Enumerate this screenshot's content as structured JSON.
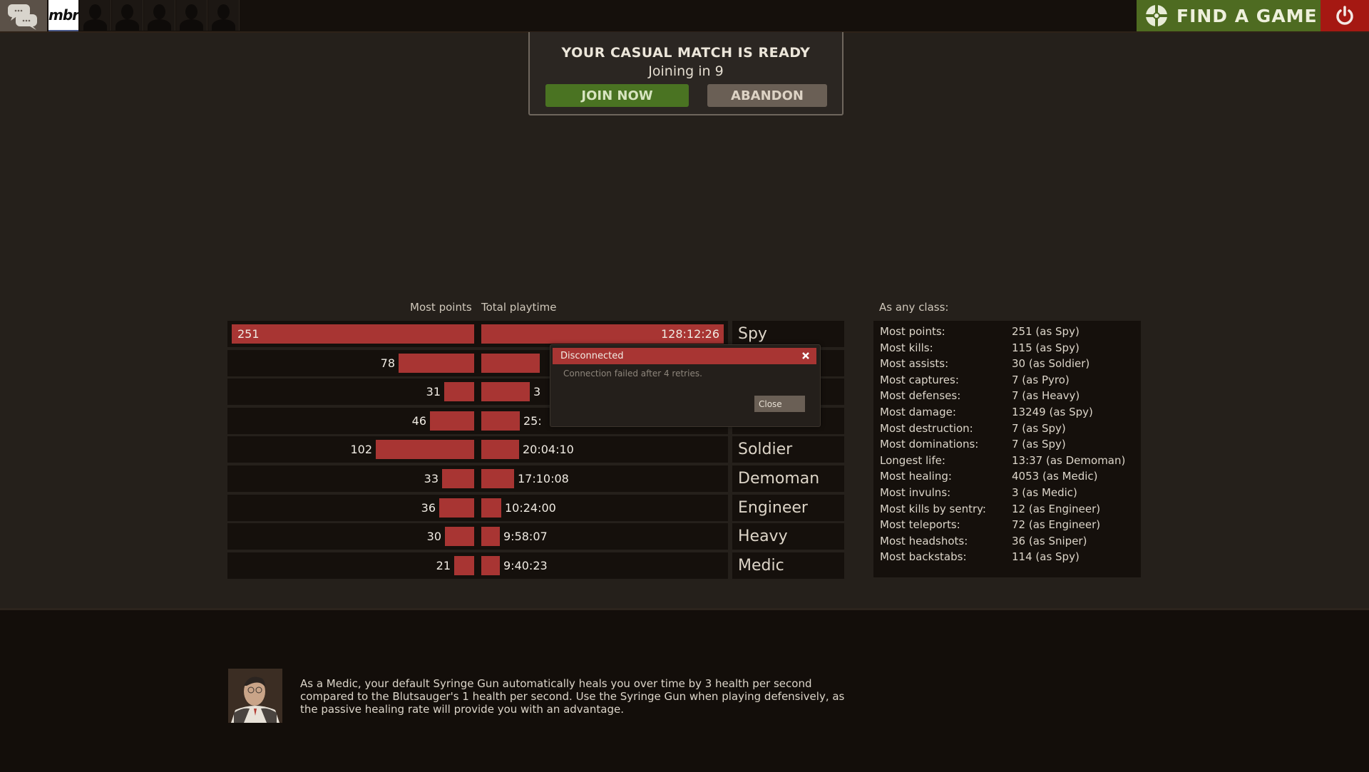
{
  "topbar": {
    "chat_icon": "chat-bubbles-icon",
    "party_avatar_label": "mbr",
    "friend_slots": 5,
    "find_game_label": "FIND A GAME",
    "find_game_color": "#4e6b21",
    "power_color": "#a51812"
  },
  "match_ready": {
    "title": "YOUR CASUAL MATCH IS READY",
    "subtitle": "Joining in 9",
    "join_label": "JOIN NOW",
    "abandon_label": "ABANDON"
  },
  "stats": {
    "col_points": "Most points",
    "col_playtime": "Total playtime",
    "bar_color": "#a83533",
    "rows": [
      {
        "points": "251",
        "points_value": 251,
        "time": "128:12:26",
        "time_value_hours": 128.207,
        "class": "Spy"
      },
      {
        "points": "78",
        "points_value": 78,
        "time": "",
        "time_value_hours": null,
        "class": ""
      },
      {
        "points": "31",
        "points_value": 31,
        "time": "3",
        "time_value_hours": null,
        "class": ""
      },
      {
        "points": "46",
        "points_value": 46,
        "time": "25:",
        "time_value_hours": null,
        "class": ""
      },
      {
        "points": "102",
        "points_value": 102,
        "time": "20:04:10",
        "time_value_hours": 20.069,
        "class": "Soldier"
      },
      {
        "points": "33",
        "points_value": 33,
        "time": "17:10:08",
        "time_value_hours": 17.169,
        "class": "Demoman"
      },
      {
        "points": "36",
        "points_value": 36,
        "time": "10:24:00",
        "time_value_hours": 10.4,
        "class": "Engineer"
      },
      {
        "points": "30",
        "points_value": 30,
        "time": "9:58:07",
        "time_value_hours": 9.969,
        "class": "Heavy"
      },
      {
        "points": "21",
        "points_value": 21,
        "time": "9:40:23",
        "time_value_hours": 9.673,
        "class": "Medic"
      }
    ],
    "hidden_bar_fractions": [
      null,
      0.24,
      0.2,
      0.16
    ]
  },
  "any_class": {
    "heading": "As any class:",
    "items": [
      {
        "label": "Most points:",
        "value": "251 (as Spy)"
      },
      {
        "label": "Most kills:",
        "value": "115 (as Spy)"
      },
      {
        "label": "Most assists:",
        "value": "30 (as Soldier)"
      },
      {
        "label": "Most captures:",
        "value": "7 (as Pyro)"
      },
      {
        "label": "Most defenses:",
        "value": "7 (as Heavy)"
      },
      {
        "label": "Most damage:",
        "value": "13249 (as Spy)"
      },
      {
        "label": "Most destruction:",
        "value": "7 (as Spy)"
      },
      {
        "label": "Most dominations:",
        "value": "7 (as Spy)"
      },
      {
        "label": "Longest life:",
        "value": "13:37 (as Demoman)"
      },
      {
        "label": "Most healing:",
        "value": "4053 (as Medic)"
      },
      {
        "label": "Most invulns:",
        "value": "3 (as Medic)"
      },
      {
        "label": "Most kills by sentry:",
        "value": "12 (as Engineer)"
      },
      {
        "label": "Most teleports:",
        "value": "72 (as Engineer)"
      },
      {
        "label": "Most headshots:",
        "value": "36 (as Sniper)"
      },
      {
        "label": "Most backstabs:",
        "value": "114 (as Spy)"
      }
    ]
  },
  "tip": {
    "portrait_icon": "medic-portrait",
    "text": "As a Medic, your default Syringe Gun automatically heals you over time by 3 health per second compared to the Blutsauger's 1 health per second. Use the Syringe Gun when playing defensively, as the passive healing rate will provide you with an advantage."
  },
  "dialog": {
    "title": "Disconnected",
    "message": "Connection failed after 4 retries.",
    "close_label": "Close"
  }
}
